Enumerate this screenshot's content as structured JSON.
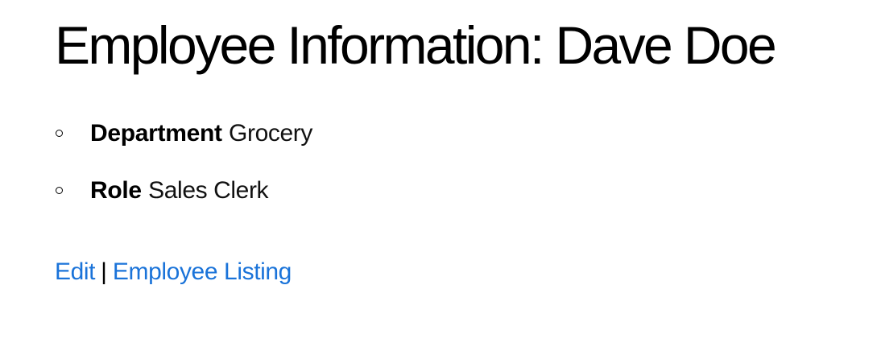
{
  "page": {
    "title": "Employee Information: Dave Doe"
  },
  "details": [
    {
      "label": "Department",
      "value": "Grocery"
    },
    {
      "label": "Role",
      "value": "Sales Clerk"
    }
  ],
  "links": {
    "edit": "Edit",
    "separator": "|",
    "listing": "Employee Listing"
  },
  "colors": {
    "link": "#1a73d9",
    "text": "#000000",
    "background": "#ffffff"
  },
  "icons": {
    "bullet": "circle-bullet-icon"
  }
}
